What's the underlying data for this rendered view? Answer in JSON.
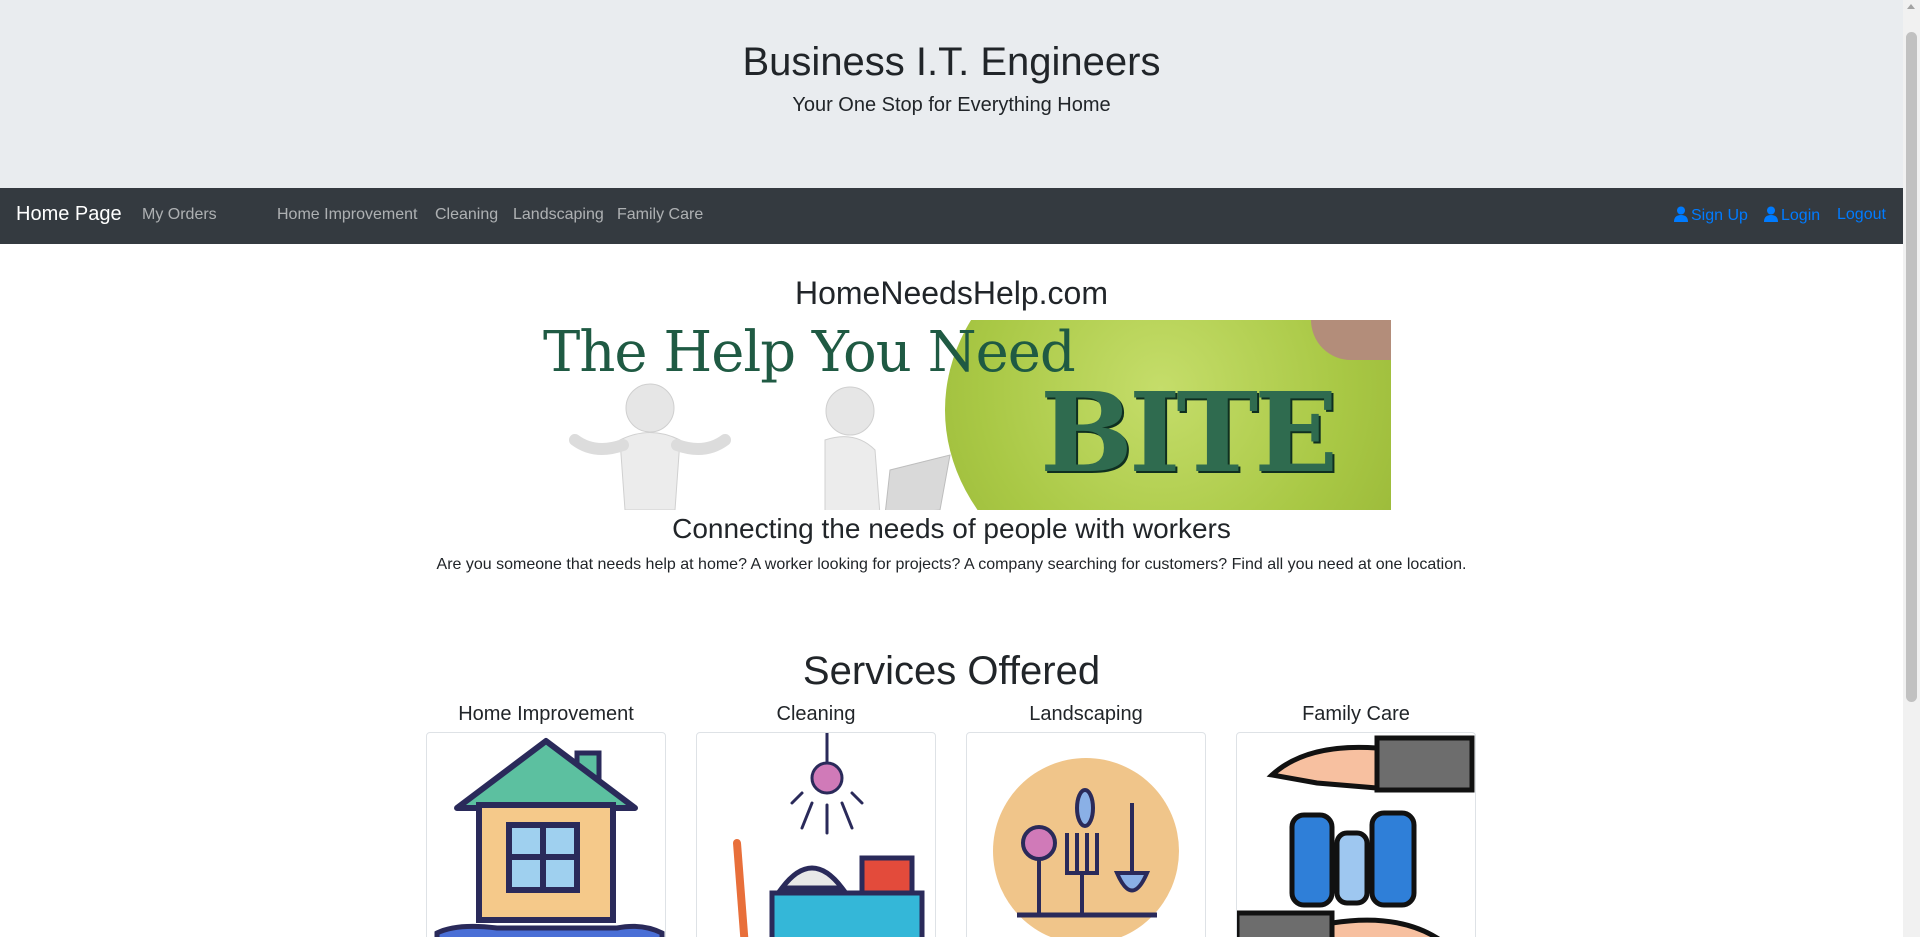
{
  "header": {
    "title": "Business I.T. Engineers",
    "subtitle": "Your One Stop for Everything Home"
  },
  "nav": {
    "brand": "Home Page",
    "my_orders": "My Orders",
    "links": [
      "Home Improvement",
      "Cleaning",
      "Landscaping",
      "Family Care"
    ],
    "sign_up": "Sign Up",
    "login": "Login",
    "logout": "Logout"
  },
  "main": {
    "site_title": "HomeNeedsHelp.com",
    "banner": {
      "text": "The Help You Need",
      "bite": "BITE"
    },
    "tagline": "Connecting the needs of people with workers",
    "description": "Are you someone that needs help at home? A worker looking for projects? A company searching for customers? Find all you need at one location."
  },
  "services": {
    "title": "Services Offered",
    "cards": [
      {
        "title": "Home Improvement",
        "icon": "house-icon"
      },
      {
        "title": "Cleaning",
        "icon": "cleaning-icon"
      },
      {
        "title": "Landscaping",
        "icon": "gardening-tools-icon"
      },
      {
        "title": "Family Care",
        "icon": "family-care-icon"
      }
    ]
  },
  "colors": {
    "jumbotron": "#e9ecef",
    "navbar": "#343a40",
    "link": "#007bff",
    "banner_green": "#1f5a43"
  }
}
